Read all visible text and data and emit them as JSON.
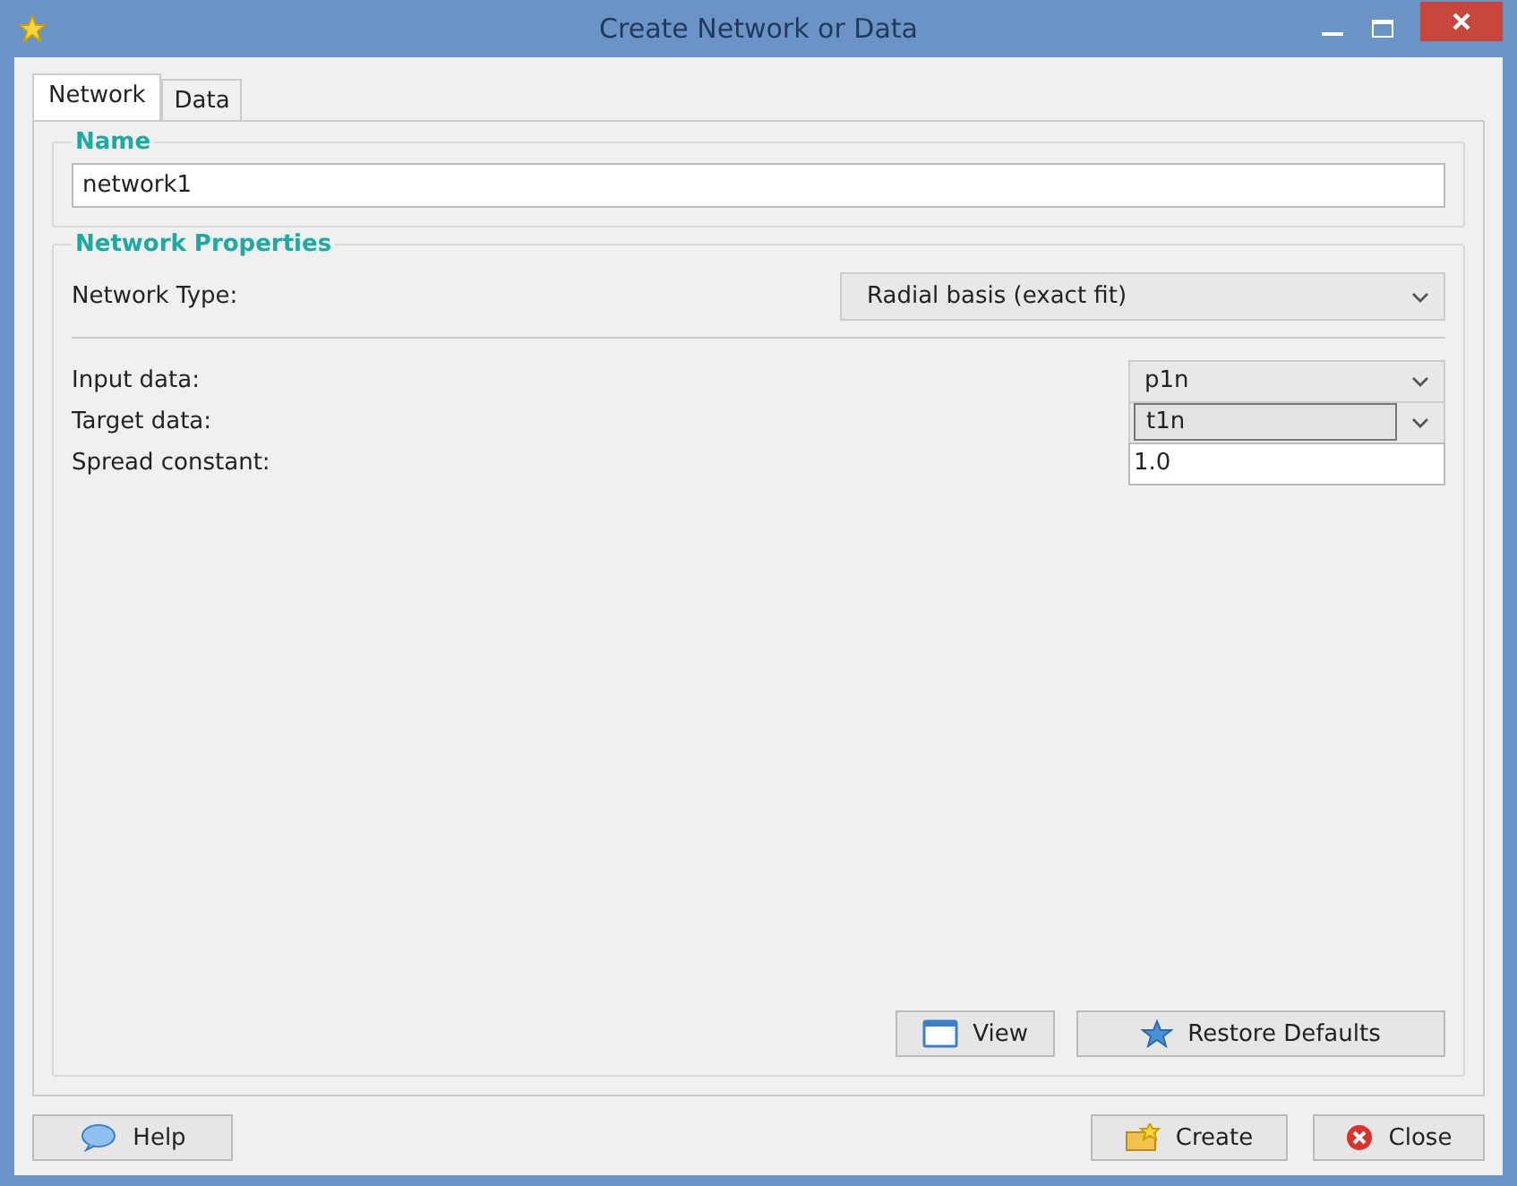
{
  "window": {
    "title": "Create Network or Data"
  },
  "tabs": [
    {
      "label": "Network",
      "selected": true
    },
    {
      "label": "Data",
      "selected": false
    }
  ],
  "name_group": {
    "title": "Name",
    "value": "network1"
  },
  "properties": {
    "title": "Network Properties",
    "network_type": {
      "label": "Network Type:",
      "value": "Radial basis (exact fit)"
    },
    "fields": [
      {
        "kind": "dropdown",
        "label": "Input data:",
        "value": "p1n",
        "focused": false
      },
      {
        "kind": "dropdown",
        "label": "Target data:",
        "value": "t1n",
        "focused": true
      },
      {
        "kind": "text",
        "label": "Spread constant:",
        "value": "1.0"
      }
    ],
    "buttons": [
      "View",
      "Restore Defaults"
    ]
  },
  "footer": {
    "help": "Help",
    "create": "Create",
    "close": "Close"
  }
}
